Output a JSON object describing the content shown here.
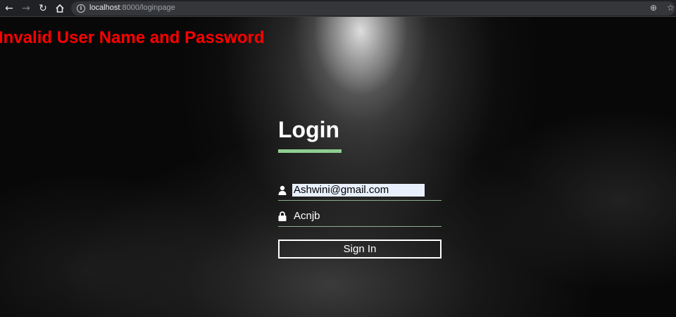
{
  "browser": {
    "back_icon": "back-arrow-icon",
    "forward_icon": "forward-arrow-icon",
    "reload_icon": "reload-icon",
    "home_icon": "home-icon",
    "url_host": "localhost",
    "url_path": ":8000/loginpage",
    "zoom_icon": "zoom-icon",
    "star_icon": "bookmark-star-icon"
  },
  "error": {
    "message": "Invalid User Name and Password",
    "color": "#ff0000"
  },
  "login": {
    "title": "Login",
    "accent_color": "#8fcf8f",
    "email_icon": "user-icon",
    "email_value": "Ashwini@gmail.com",
    "password_icon": "lock-icon",
    "password_value": "Acnjb",
    "signin_label": "Sign In"
  }
}
